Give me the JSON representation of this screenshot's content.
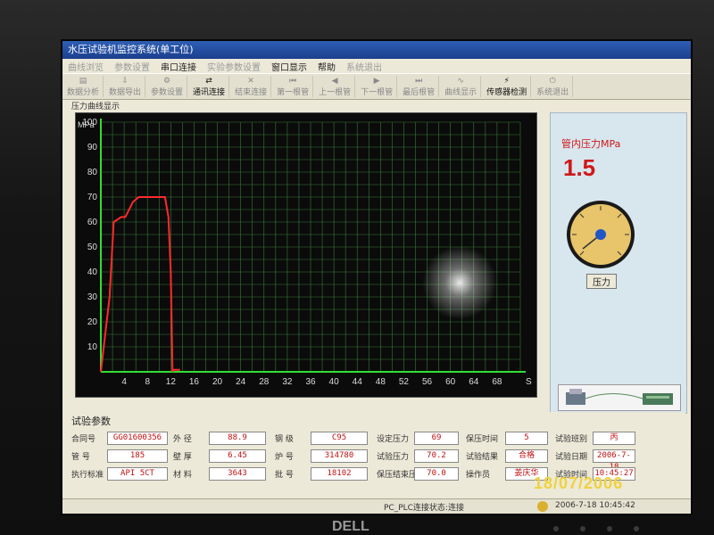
{
  "window": {
    "title": "水压试验机监控系统(单工位)"
  },
  "menu": [
    "曲线浏览",
    "参数设置",
    "串口连接",
    "实验参数设置",
    "窗口显示",
    "帮助",
    "系统退出"
  ],
  "toolbar": [
    {
      "icon": "chart-icon",
      "label": "数据分析",
      "enabled": false
    },
    {
      "icon": "export-icon",
      "label": "数据导出",
      "enabled": false
    },
    {
      "icon": "settings-icon",
      "label": "参数设置",
      "enabled": false
    },
    {
      "icon": "connect-icon",
      "label": "通讯连接",
      "enabled": true
    },
    {
      "icon": "disconnect-icon",
      "label": "结束连接",
      "enabled": false
    },
    {
      "icon": "first-icon",
      "label": "第一根管",
      "enabled": false
    },
    {
      "icon": "prev-icon",
      "label": "上一根管",
      "enabled": false
    },
    {
      "icon": "next-icon",
      "label": "下一根管",
      "enabled": false
    },
    {
      "icon": "last-icon",
      "label": "最后根管",
      "enabled": false
    },
    {
      "icon": "curve-icon",
      "label": "曲线显示",
      "enabled": false
    },
    {
      "icon": "sensor-icon",
      "label": "传感器检测",
      "enabled": true
    },
    {
      "icon": "exit-icon",
      "label": "系统退出",
      "enabled": false
    }
  ],
  "chart_panel": {
    "caption": "压力曲线显示"
  },
  "chart_data": {
    "type": "line",
    "ylabel": "MPa",
    "xlabel": "S",
    "ylim": [
      0,
      100
    ],
    "xlim": [
      0,
      72
    ],
    "yticks": [
      10,
      20,
      30,
      40,
      50,
      60,
      70,
      80,
      90,
      100
    ],
    "xticks": [
      4,
      8,
      12,
      16,
      20,
      24,
      28,
      32,
      36,
      40,
      44,
      48,
      52,
      56,
      60,
      64,
      68
    ],
    "grid": true,
    "series": [
      {
        "color": "#ff2a2a",
        "x": [
          0,
          1.5,
          2.2,
          3.5,
          4.2,
          5.5,
          6.5,
          11,
          11.6,
          12,
          12.3,
          12.4,
          13.6
        ],
        "y": [
          0,
          30,
          60,
          62,
          62,
          68,
          70,
          70,
          62,
          40,
          0,
          0.8,
          0.8
        ]
      }
    ]
  },
  "right_panel": {
    "pressure_label": "管内压力MPa",
    "pressure_value": "1.5",
    "gauge_label": "压力"
  },
  "params": {
    "title": "试验参数",
    "fields": [
      {
        "label": "合同号",
        "value": "GG01600356"
      },
      {
        "label": "管 号",
        "value": "185"
      },
      {
        "label": "执行标准",
        "value": "API 5CT"
      },
      {
        "label": "外 径",
        "value": "88.9"
      },
      {
        "label": "壁 厚",
        "value": "6.45"
      },
      {
        "label": "材 料",
        "value": "3643"
      },
      {
        "label": "钢 级",
        "value": "C95"
      },
      {
        "label": "炉 号",
        "value": "314780"
      },
      {
        "label": "批 号",
        "value": "18102"
      },
      {
        "label": "设定压力",
        "value": "69"
      },
      {
        "label": "试验压力",
        "value": "70.2"
      },
      {
        "label": "保压结束压力",
        "value": "70.0"
      },
      {
        "label": "保压时间",
        "value": "5"
      },
      {
        "label": "试验结果",
        "value": "合格"
      },
      {
        "label": "操作员",
        "value": "姜庆华"
      },
      {
        "label": "试验班别",
        "value": "丙"
      },
      {
        "label": "试验日期",
        "value": "2006-7-18"
      },
      {
        "label": "试验时间",
        "value": "10:45:27"
      }
    ]
  },
  "status": {
    "connection": "PC_PLC连接状态:连接",
    "datetime": "2006-7-18 10:45:42"
  },
  "camera_timestamp": "18/07/2006",
  "brand": "DELL"
}
